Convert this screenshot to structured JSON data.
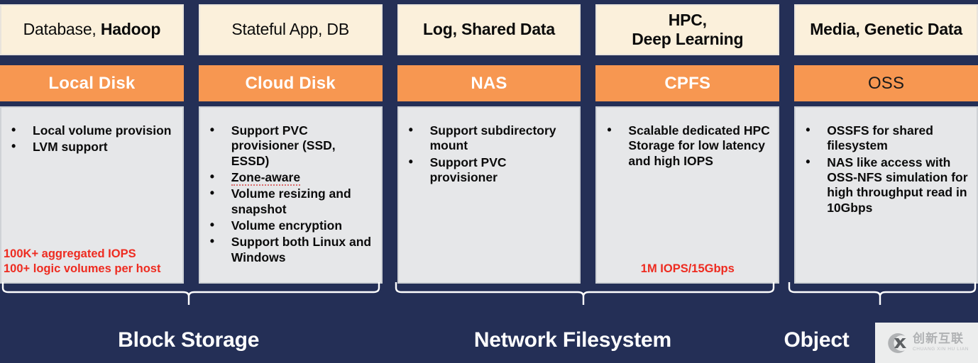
{
  "columns": [
    {
      "usecase_plain": "Database, ",
      "usecase_bold": "Hadoop",
      "product": "Local Disk",
      "product_text_color": "#ffffff",
      "features": [
        "Local volume provision",
        "LVM support"
      ],
      "metric": "100K+ aggregated IOPS\n100+ logic volumes per host",
      "metric_line1": "100K+ aggregated IOPS",
      "metric_line2": "100+ logic volumes per host"
    },
    {
      "usecase_plain": "Stateful App, DB",
      "usecase_bold": "",
      "product": "Cloud Disk",
      "product_text_color": "#ffffff",
      "features": [
        "Support PVC provisioner (SSD, ESSD)",
        "Zone-aware",
        "Volume resizing and snapshot",
        "Volume encryption",
        "Support both Linux and Windows"
      ],
      "metric_line1": "",
      "metric_line2": ""
    },
    {
      "usecase_plain": "",
      "usecase_bold": "Log, Shared Data",
      "product": "NAS",
      "product_text_color": "#ffffff",
      "features": [
        "Support subdirectory mount",
        "Support PVC provisioner"
      ],
      "metric_line1": "",
      "metric_line2": ""
    },
    {
      "usecase_plain": "",
      "usecase_bold": "HPC,\nDeep Learning",
      "usecase_bold_l1": "HPC,",
      "usecase_bold_l2": "Deep Learning",
      "product": "CPFS",
      "product_text_color": "#ffffff",
      "features": [
        "Scalable dedicated HPC Storage for low latency and high IOPS"
      ],
      "metric_line1": "1M IOPS/15Gbps",
      "metric_line2": ""
    },
    {
      "usecase_plain": "",
      "usecase_bold": "Media, Genetic Data",
      "product": "OSS",
      "product_text_color": "#1a1a1a",
      "features": [
        "OSSFS for shared filesystem",
        "NAS like access with OSS-NFS simulation for high throughput read in 10Gbps"
      ],
      "metric_line1": "",
      "metric_line2": ""
    }
  ],
  "groups": [
    {
      "label": "Block Storage"
    },
    {
      "label": "Network Filesystem"
    },
    {
      "label": "Object"
    }
  ],
  "watermark": {
    "cn": "创新互联",
    "en": "CHUANG XIN HU LIAN",
    "mark": "cx-logo-icon"
  },
  "colors": {
    "background": "#242f56",
    "usecase_bg": "#fbf0db",
    "product_bg": "#f79751",
    "features_bg": "#e6e7e9",
    "metric_red": "#ee2b20",
    "label_white": "#ffffff"
  }
}
